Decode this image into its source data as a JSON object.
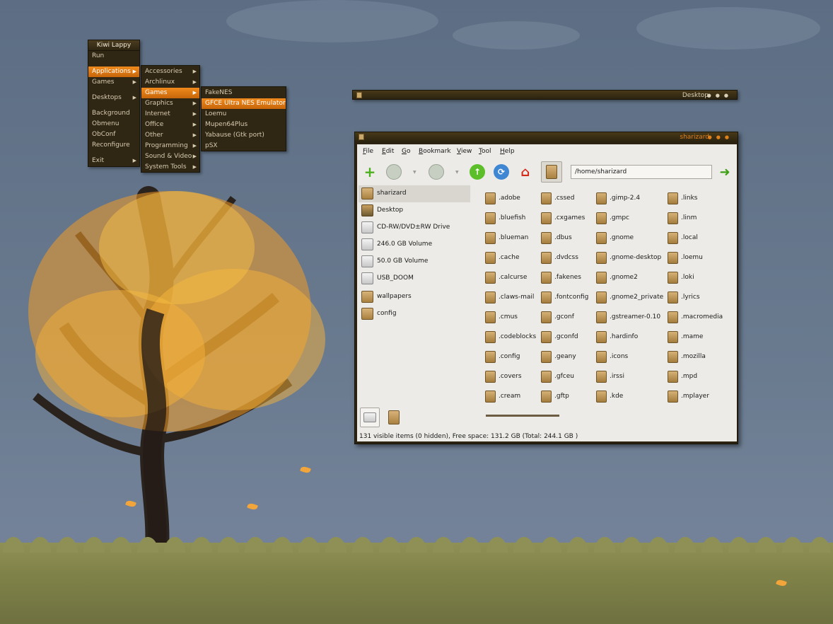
{
  "root_menu": {
    "title": "Kiwi Lappy",
    "items": [
      {
        "label": "Run",
        "submenu": false
      },
      {
        "label": "Applications",
        "submenu": true,
        "active": true
      },
      {
        "label": "Games",
        "submenu": true
      },
      {
        "label": "Desktops",
        "submenu": true
      },
      {
        "label": "Background",
        "submenu": false
      },
      {
        "label": "Obmenu",
        "submenu": false
      },
      {
        "label": "ObConf",
        "submenu": false
      },
      {
        "label": "Reconfigure",
        "submenu": false
      },
      {
        "label": "Exit",
        "submenu": true
      }
    ]
  },
  "applications_menu": {
    "items": [
      {
        "label": "Accessories"
      },
      {
        "label": "Archlinux"
      },
      {
        "label": "Games",
        "active": true
      },
      {
        "label": "Graphics"
      },
      {
        "label": "Internet"
      },
      {
        "label": "Office"
      },
      {
        "label": "Other"
      },
      {
        "label": "Programming"
      },
      {
        "label": "Sound & Video"
      },
      {
        "label": "System Tools"
      }
    ]
  },
  "games_menu": {
    "items": [
      {
        "label": "FakeNES"
      },
      {
        "label": "GFCE Ultra NES Emulator",
        "active": true
      },
      {
        "label": "Loemu"
      },
      {
        "label": "Mupen64Plus"
      },
      {
        "label": "Yabause (Gtk port)"
      },
      {
        "label": "pSX"
      }
    ]
  },
  "desktop_window": {
    "title": "Desktop"
  },
  "file_manager": {
    "title": "sharizard",
    "menubar": [
      {
        "label": "File",
        "mnemonic": "F",
        "rest": "ile"
      },
      {
        "label": "Edit",
        "mnemonic": "E",
        "rest": "dit"
      },
      {
        "label": "Go",
        "mnemonic": "G",
        "rest": "o"
      },
      {
        "label": "Bookmark",
        "mnemonic": "B",
        "rest": "ookmark"
      },
      {
        "label": "View",
        "mnemonic": "V",
        "rest": "iew"
      },
      {
        "label": "Tool",
        "mnemonic": "T",
        "rest": "ool"
      },
      {
        "label": "Help",
        "mnemonic": "H",
        "rest": "elp"
      }
    ],
    "path": "/home/sharizard",
    "sidebar": [
      {
        "label": "sharizard",
        "icon": "home-folder-icon",
        "selected": true
      },
      {
        "label": "Desktop",
        "icon": "desktop-icon"
      },
      {
        "label": "CD-RW/DVD±RW Drive",
        "icon": "optical-drive-icon"
      },
      {
        "label": "246.0 GB Volume",
        "icon": "drive-icon"
      },
      {
        "label": "50.0 GB Volume",
        "icon": "drive-icon"
      },
      {
        "label": "USB_DOOM",
        "icon": "usb-drive-icon"
      },
      {
        "label": "wallpapers",
        "icon": "folder-icon"
      },
      {
        "label": "config",
        "icon": "folder-icon"
      }
    ],
    "files": [
      [
        ".adobe",
        ".bluefish",
        ".blueman",
        ".cache",
        ".calcurse",
        ".claws-mail",
        ".cmus",
        ".codeblocks",
        ".config",
        ".covers",
        ".cream"
      ],
      [
        ".cssed",
        ".cxgames",
        ".dbus",
        ".dvdcss",
        ".fakenes",
        ".fontconfig",
        ".gconf",
        ".gconfd",
        ".geany",
        ".gfceu",
        ".gftp"
      ],
      [
        ".gimp-2.4",
        ".gmpc",
        ".gnome",
        ".gnome-desktop",
        ".gnome2",
        ".gnome2_private",
        ".gstreamer-0.10",
        ".hardinfo",
        ".icons",
        ".irssi",
        ".kde"
      ],
      [
        ".links",
        ".linm",
        ".local",
        ".loemu",
        ".loki",
        ".lyrics",
        ".macromedia",
        ".mame",
        ".mozilla",
        ".mpd",
        ".mplayer"
      ]
    ],
    "status": "131 visible items (0 hidden), Free space: 131.2 GB (Total: 244.1 GB )"
  }
}
